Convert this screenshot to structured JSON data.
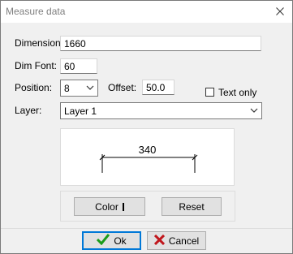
{
  "window": {
    "title": "Measure data"
  },
  "icons": {
    "close": "close-icon",
    "ok": "checkmark-icon",
    "cancel": "red-x-icon",
    "dropdown": "chevron-down-icon"
  },
  "fields": {
    "dimension": {
      "label": "Dimension:",
      "value": "1660"
    },
    "dim_font": {
      "label": "Dim Font:",
      "value": "60"
    },
    "position": {
      "label": "Position:",
      "value": "8"
    },
    "offset": {
      "label": "Offset:",
      "value": "50.0"
    },
    "text_only": {
      "label": "Text only",
      "checked": false
    },
    "layer": {
      "label": "Layer:",
      "value": "Layer 1"
    }
  },
  "preview": {
    "text": "340"
  },
  "buttons": {
    "color": "Color",
    "reset": "Reset",
    "ok": "Ok",
    "cancel": "Cancel"
  },
  "colors": {
    "ok_check": "#1a9c1a",
    "cancel_x": "#c0161c",
    "focus": "#0078d7"
  }
}
